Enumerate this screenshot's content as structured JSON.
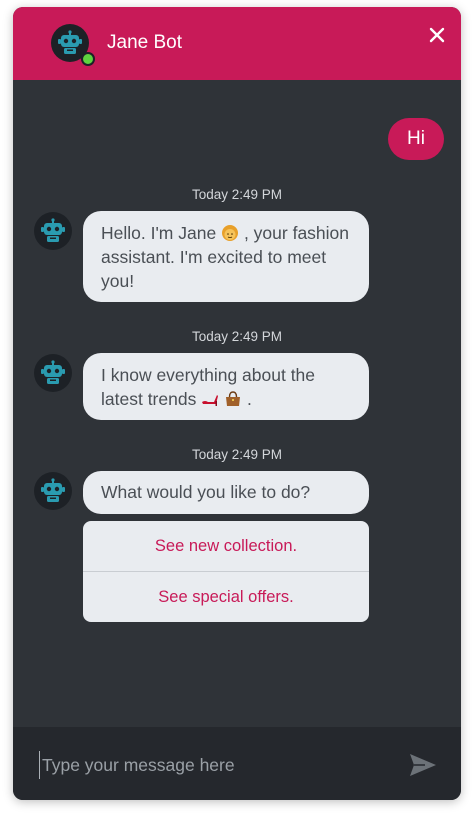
{
  "header": {
    "bot_name": "Jane Bot"
  },
  "messages": {
    "user_greeting": "Hi",
    "groups": [
      {
        "timestamp": "Today 2:49 PM",
        "text_before": "Hello. I'm Jane",
        "text_after": ", your fashion assistant. I'm excited to meet you!",
        "emoji": "woman-emoji"
      },
      {
        "timestamp": "Today 2:49 PM",
        "text_before": "I know everything about the latest trends",
        "text_after": ".",
        "emoji": "high-heel-emoji, handbag-emoji"
      },
      {
        "timestamp": "Today 2:49 PM",
        "text": "What would you like to do?"
      }
    ],
    "options": [
      "See new collection.",
      "See special offers."
    ]
  },
  "input": {
    "placeholder": "Type your message here"
  },
  "colors": {
    "accent": "#c81a58",
    "panel": "#2f3338",
    "input_bar": "#25282d",
    "bubble": "#e9ecf0",
    "online": "#5ed33f"
  }
}
